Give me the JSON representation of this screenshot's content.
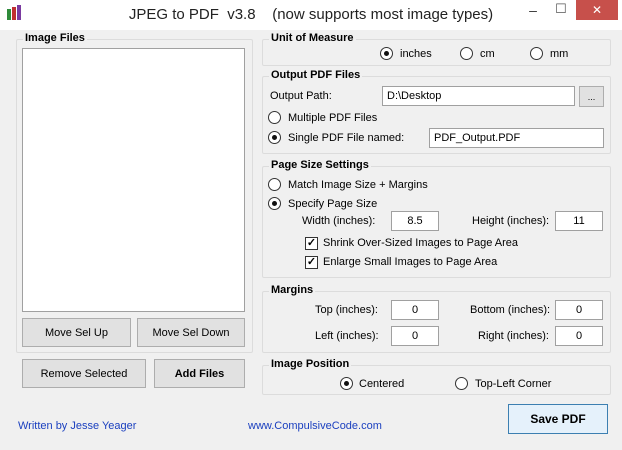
{
  "window": {
    "title": "JPEG to PDF  v3.8    (now supports most image types)",
    "minimize": "‒",
    "maximize": "☐",
    "close": "✕"
  },
  "image_files": {
    "label": "Image Files",
    "move_up": "Move Sel Up",
    "move_down": "Move Sel Down",
    "remove": "Remove Selected",
    "add": "Add Files"
  },
  "unit": {
    "label": "Unit of Measure",
    "options": [
      "inches",
      "cm",
      "mm"
    ],
    "selected": "inches"
  },
  "output": {
    "label": "Output PDF Files",
    "path_label": "Output Path:",
    "path_value": "D:\\Desktop",
    "browse": "...",
    "multiple": "Multiple PDF Files",
    "single": "Single PDF File named:",
    "single_value": "PDF_Output.PDF"
  },
  "page_size": {
    "label": "Page Size Settings",
    "match": "Match Image Size + Margins",
    "specify": "Specify Page Size",
    "width_label": "Width (inches):",
    "width": "8.5",
    "height_label": "Height (inches):",
    "height": "11",
    "shrink": "Shrink Over-Sized Images to Page Area",
    "enlarge": "Enlarge Small Images to Page Area"
  },
  "margins": {
    "label": "Margins",
    "top_label": "Top (inches):",
    "top": "0",
    "bottom_label": "Bottom (inches):",
    "bottom": "0",
    "left_label": "Left (inches):",
    "left": "0",
    "right_label": "Right (inches):",
    "right": "0"
  },
  "position": {
    "label": "Image Position",
    "centered": "Centered",
    "topleft": "Top-Left Corner"
  },
  "footer": {
    "author": "Written by Jesse Yeager",
    "website": "www.CompulsiveCode.com",
    "save": "Save PDF"
  }
}
